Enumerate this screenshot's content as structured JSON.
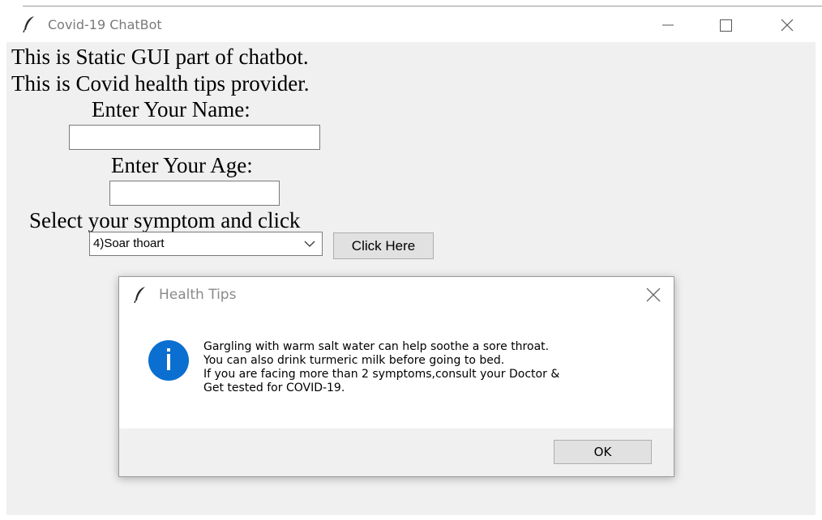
{
  "main_window": {
    "title": "Covid-19 ChatBot",
    "lines": [
      "This is Static GUI part of chatbot.",
      "This is Covid health tips provider."
    ],
    "name_label": "Enter Your Name:",
    "name_value": "",
    "age_label": "Enter Your Age:",
    "age_value": "",
    "symptom_label": "Select your symptom and click",
    "symptom_selected": "4)Soar thoart",
    "button_label": "Click Here"
  },
  "dialog": {
    "title": "Health Tips",
    "icon": "info-icon",
    "message_lines": [
      "Gargling with warm salt water can help soothe a sore throat.",
      "You can also drink turmeric milk before going to bed.",
      "If you are facing more than 2 symptoms,consult your Doctor &",
      "Get tested for COVID-19."
    ],
    "ok_label": "OK"
  },
  "icons": {
    "app": "feather-icon",
    "minimize": "minimize-icon",
    "maximize": "maximize-icon",
    "close": "close-icon",
    "dropdown": "chevron-down-icon"
  },
  "colors": {
    "window_bg": "#f0f0f0",
    "titlebar_bg": "#ffffff",
    "info_blue": "#0a6fd0"
  }
}
